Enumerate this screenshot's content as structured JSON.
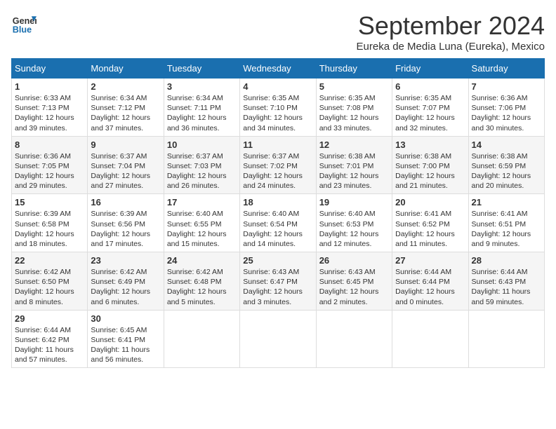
{
  "header": {
    "logo_line1": "General",
    "logo_line2": "Blue",
    "month_title": "September 2024",
    "subtitle": "Eureka de Media Luna (Eureka), Mexico"
  },
  "weekdays": [
    "Sunday",
    "Monday",
    "Tuesday",
    "Wednesday",
    "Thursday",
    "Friday",
    "Saturday"
  ],
  "weeks": [
    [
      {
        "day": "1",
        "sunrise": "Sunrise: 6:33 AM",
        "sunset": "Sunset: 7:13 PM",
        "daylight": "Daylight: 12 hours and 39 minutes."
      },
      {
        "day": "2",
        "sunrise": "Sunrise: 6:34 AM",
        "sunset": "Sunset: 7:12 PM",
        "daylight": "Daylight: 12 hours and 37 minutes."
      },
      {
        "day": "3",
        "sunrise": "Sunrise: 6:34 AM",
        "sunset": "Sunset: 7:11 PM",
        "daylight": "Daylight: 12 hours and 36 minutes."
      },
      {
        "day": "4",
        "sunrise": "Sunrise: 6:35 AM",
        "sunset": "Sunset: 7:10 PM",
        "daylight": "Daylight: 12 hours and 34 minutes."
      },
      {
        "day": "5",
        "sunrise": "Sunrise: 6:35 AM",
        "sunset": "Sunset: 7:08 PM",
        "daylight": "Daylight: 12 hours and 33 minutes."
      },
      {
        "day": "6",
        "sunrise": "Sunrise: 6:35 AM",
        "sunset": "Sunset: 7:07 PM",
        "daylight": "Daylight: 12 hours and 32 minutes."
      },
      {
        "day": "7",
        "sunrise": "Sunrise: 6:36 AM",
        "sunset": "Sunset: 7:06 PM",
        "daylight": "Daylight: 12 hours and 30 minutes."
      }
    ],
    [
      {
        "day": "8",
        "sunrise": "Sunrise: 6:36 AM",
        "sunset": "Sunset: 7:05 PM",
        "daylight": "Daylight: 12 hours and 29 minutes."
      },
      {
        "day": "9",
        "sunrise": "Sunrise: 6:37 AM",
        "sunset": "Sunset: 7:04 PM",
        "daylight": "Daylight: 12 hours and 27 minutes."
      },
      {
        "day": "10",
        "sunrise": "Sunrise: 6:37 AM",
        "sunset": "Sunset: 7:03 PM",
        "daylight": "Daylight: 12 hours and 26 minutes."
      },
      {
        "day": "11",
        "sunrise": "Sunrise: 6:37 AM",
        "sunset": "Sunset: 7:02 PM",
        "daylight": "Daylight: 12 hours and 24 minutes."
      },
      {
        "day": "12",
        "sunrise": "Sunrise: 6:38 AM",
        "sunset": "Sunset: 7:01 PM",
        "daylight": "Daylight: 12 hours and 23 minutes."
      },
      {
        "day": "13",
        "sunrise": "Sunrise: 6:38 AM",
        "sunset": "Sunset: 7:00 PM",
        "daylight": "Daylight: 12 hours and 21 minutes."
      },
      {
        "day": "14",
        "sunrise": "Sunrise: 6:38 AM",
        "sunset": "Sunset: 6:59 PM",
        "daylight": "Daylight: 12 hours and 20 minutes."
      }
    ],
    [
      {
        "day": "15",
        "sunrise": "Sunrise: 6:39 AM",
        "sunset": "Sunset: 6:58 PM",
        "daylight": "Daylight: 12 hours and 18 minutes."
      },
      {
        "day": "16",
        "sunrise": "Sunrise: 6:39 AM",
        "sunset": "Sunset: 6:56 PM",
        "daylight": "Daylight: 12 hours and 17 minutes."
      },
      {
        "day": "17",
        "sunrise": "Sunrise: 6:40 AM",
        "sunset": "Sunset: 6:55 PM",
        "daylight": "Daylight: 12 hours and 15 minutes."
      },
      {
        "day": "18",
        "sunrise": "Sunrise: 6:40 AM",
        "sunset": "Sunset: 6:54 PM",
        "daylight": "Daylight: 12 hours and 14 minutes."
      },
      {
        "day": "19",
        "sunrise": "Sunrise: 6:40 AM",
        "sunset": "Sunset: 6:53 PM",
        "daylight": "Daylight: 12 hours and 12 minutes."
      },
      {
        "day": "20",
        "sunrise": "Sunrise: 6:41 AM",
        "sunset": "Sunset: 6:52 PM",
        "daylight": "Daylight: 12 hours and 11 minutes."
      },
      {
        "day": "21",
        "sunrise": "Sunrise: 6:41 AM",
        "sunset": "Sunset: 6:51 PM",
        "daylight": "Daylight: 12 hours and 9 minutes."
      }
    ],
    [
      {
        "day": "22",
        "sunrise": "Sunrise: 6:42 AM",
        "sunset": "Sunset: 6:50 PM",
        "daylight": "Daylight: 12 hours and 8 minutes."
      },
      {
        "day": "23",
        "sunrise": "Sunrise: 6:42 AM",
        "sunset": "Sunset: 6:49 PM",
        "daylight": "Daylight: 12 hours and 6 minutes."
      },
      {
        "day": "24",
        "sunrise": "Sunrise: 6:42 AM",
        "sunset": "Sunset: 6:48 PM",
        "daylight": "Daylight: 12 hours and 5 minutes."
      },
      {
        "day": "25",
        "sunrise": "Sunrise: 6:43 AM",
        "sunset": "Sunset: 6:47 PM",
        "daylight": "Daylight: 12 hours and 3 minutes."
      },
      {
        "day": "26",
        "sunrise": "Sunrise: 6:43 AM",
        "sunset": "Sunset: 6:45 PM",
        "daylight": "Daylight: 12 hours and 2 minutes."
      },
      {
        "day": "27",
        "sunrise": "Sunrise: 6:44 AM",
        "sunset": "Sunset: 6:44 PM",
        "daylight": "Daylight: 12 hours and 0 minutes."
      },
      {
        "day": "28",
        "sunrise": "Sunrise: 6:44 AM",
        "sunset": "Sunset: 6:43 PM",
        "daylight": "Daylight: 11 hours and 59 minutes."
      }
    ],
    [
      {
        "day": "29",
        "sunrise": "Sunrise: 6:44 AM",
        "sunset": "Sunset: 6:42 PM",
        "daylight": "Daylight: 11 hours and 57 minutes."
      },
      {
        "day": "30",
        "sunrise": "Sunrise: 6:45 AM",
        "sunset": "Sunset: 6:41 PM",
        "daylight": "Daylight: 11 hours and 56 minutes."
      },
      null,
      null,
      null,
      null,
      null
    ]
  ]
}
